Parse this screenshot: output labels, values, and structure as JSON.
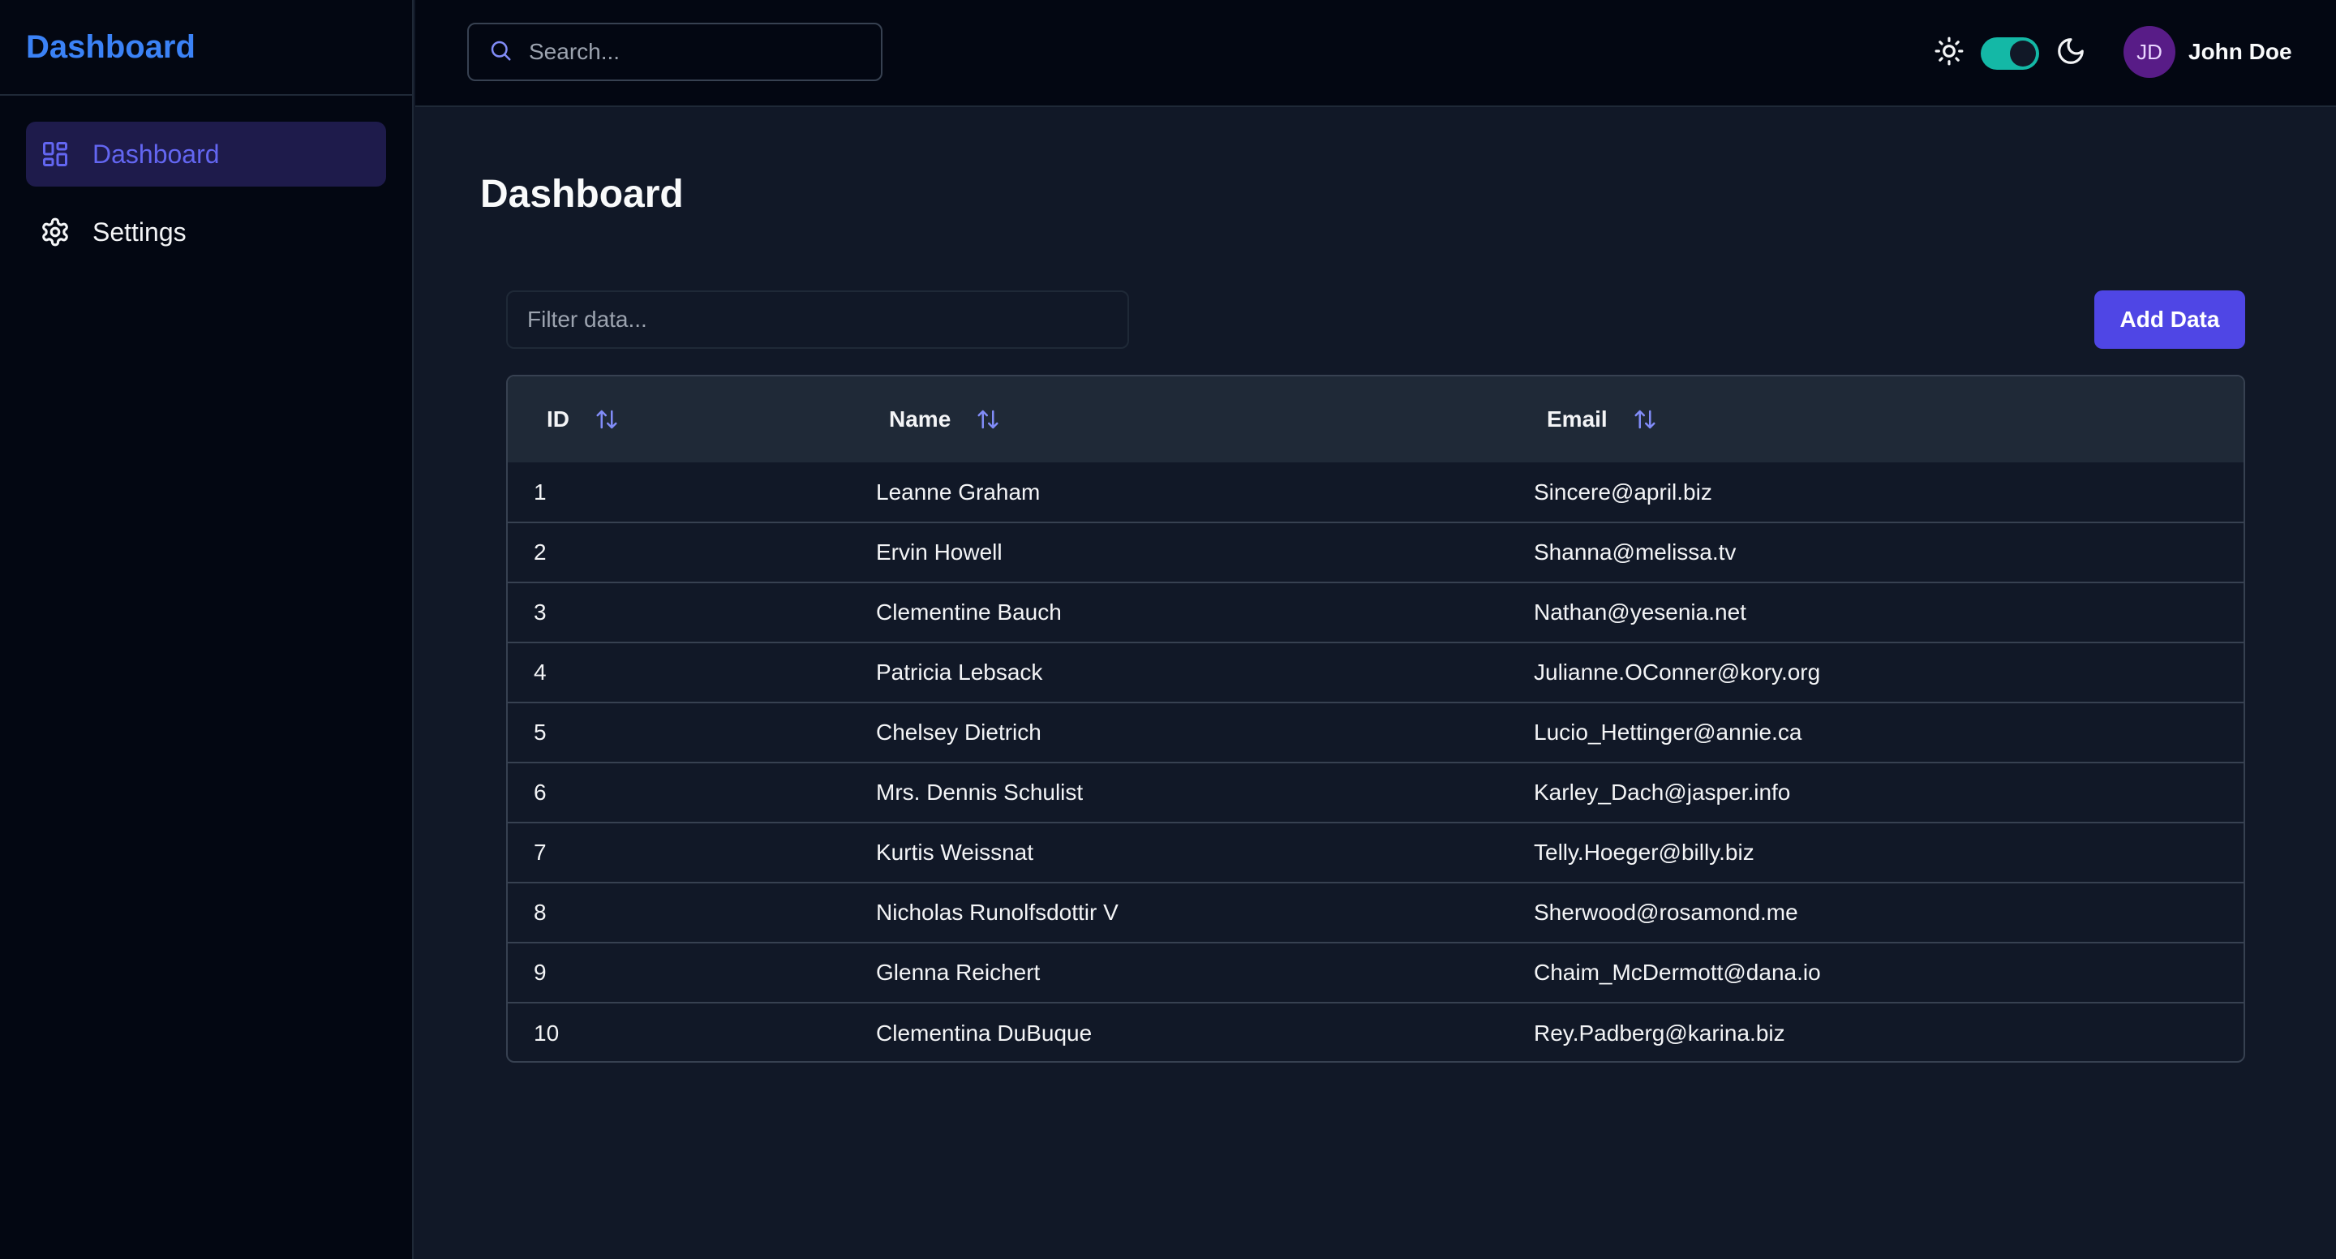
{
  "sidebar": {
    "brand": "Dashboard",
    "items": [
      {
        "label": "Dashboard",
        "icon": "grid-icon",
        "active": true
      },
      {
        "label": "Settings",
        "icon": "gear-icon",
        "active": false
      }
    ]
  },
  "header": {
    "search_placeholder": "Search...",
    "theme_toggle_on": true,
    "user": {
      "initials": "JD",
      "name": "John Doe"
    }
  },
  "main": {
    "title": "Dashboard",
    "filter_placeholder": "Filter data...",
    "add_button": "Add Data",
    "table": {
      "columns": [
        "ID",
        "Name",
        "Email"
      ],
      "rows": [
        [
          "1",
          "Leanne Graham",
          "Sincere@april.biz"
        ],
        [
          "2",
          "Ervin Howell",
          "Shanna@melissa.tv"
        ],
        [
          "3",
          "Clementine Bauch",
          "Nathan@yesenia.net"
        ],
        [
          "4",
          "Patricia Lebsack",
          "Julianne.OConner@kory.org"
        ],
        [
          "5",
          "Chelsey Dietrich",
          "Lucio_Hettinger@annie.ca"
        ],
        [
          "6",
          "Mrs. Dennis Schulist",
          "Karley_Dach@jasper.info"
        ],
        [
          "7",
          "Kurtis Weissnat",
          "Telly.Hoeger@billy.biz"
        ],
        [
          "8",
          "Nicholas Runolfsdottir V",
          "Sherwood@rosamond.me"
        ],
        [
          "9",
          "Glenna Reichert",
          "Chaim_McDermott@dana.io"
        ],
        [
          "10",
          "Clementina DuBuque",
          "Rey.Padberg@karina.biz"
        ]
      ]
    }
  },
  "colors": {
    "accent": "#4f46e5",
    "brand": "#3b82f6",
    "toggle": "#14b8a6",
    "avatar": "#581c87"
  }
}
